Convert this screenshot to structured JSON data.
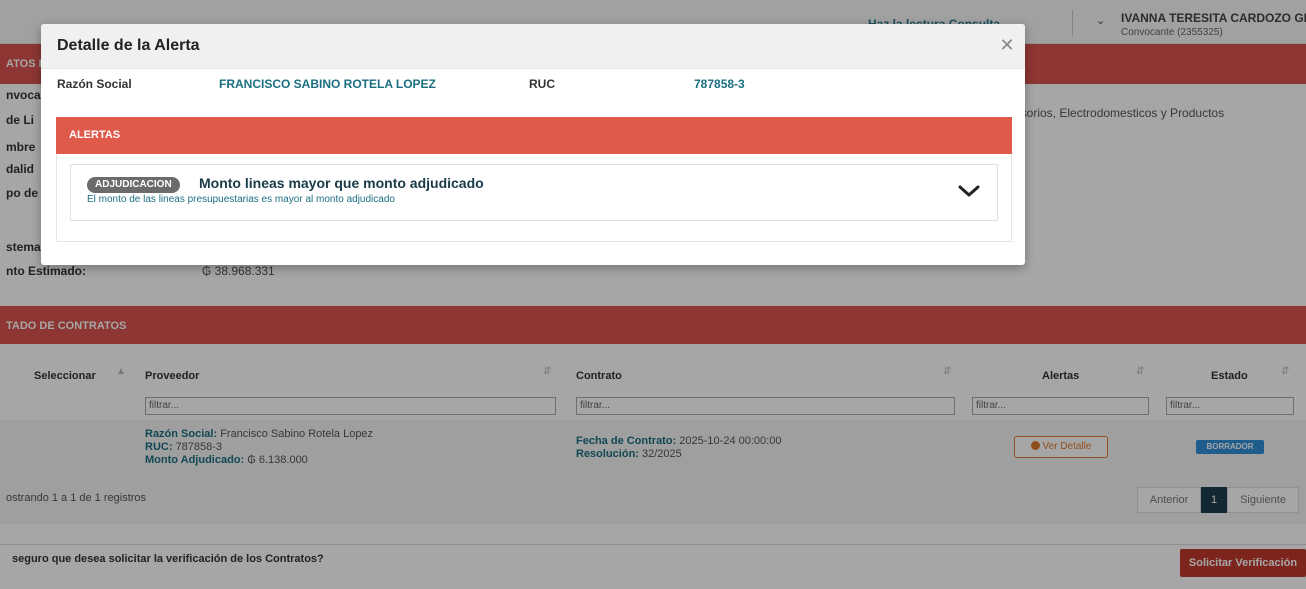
{
  "topbar": {
    "nav_link": "Haz la lectura Consulta",
    "user_name": "IVANNA TERESITA CARDOZO GE",
    "user_role": "Convocante (2355325)"
  },
  "background": {
    "section_datos_label": "ATOS D",
    "field_labels": [
      "nvoca",
      "de Li",
      "mbre",
      "dalid",
      "po de",
      "stema",
      "nto Estimado:"
    ],
    "monto_estimado": "₲ 38.968.331",
    "categoria_text": "esorios, Electrodomesticos y Productos",
    "section_contratos_label": "TADO DE CONTRATOS",
    "table": {
      "headers": [
        "Seleccionar",
        "Proveedor",
        "Contrato",
        "Alertas",
        "Estado"
      ],
      "filter_placeholder": "filtrar...",
      "row": {
        "razon_social_label": "Razón Social:",
        "razon_social": "Francisco Sabino Rotela Lopez",
        "ruc_label": "RUC:",
        "ruc": "787858-3",
        "monto_label": "Monto Adjudicado:",
        "monto": "₲ 6.138.000",
        "fecha_label": "Fecha de Contrato:",
        "fecha": "2025-10-24 00:00:00",
        "resolucion_label": "Resolución:",
        "resolucion": "32/2025",
        "ver_detalle": "Ver Detalle",
        "estado": "BORRADOR"
      }
    },
    "showing": "ostrando 1 a 1 de 1 registros",
    "pager": {
      "prev": "Anterior",
      "page": "1",
      "next": "Siguiente"
    },
    "confirm_text": "seguro que desea solicitar la verificación de los Contratos?",
    "solicitar": "Solicitar Verificación"
  },
  "modal": {
    "title": "Detalle de la Alerta",
    "razon_social_label": "Razón Social",
    "razon_social": "FRANCISCO SABINO ROTELA LOPEZ",
    "ruc_label": "RUC",
    "ruc": "787858-3",
    "alerts_header": "ALERTAS",
    "alert": {
      "tag": "ADJUDICACION",
      "title": "Monto lineas mayor que monto adjudicado",
      "description": "El monto de las lineas presupuestarias es mayor al monto adjudicado"
    }
  },
  "colors": {
    "accent_red": "#d9534f",
    "teal_text": "#1a6f82",
    "orange": "#e0792b",
    "badge_blue": "#2f8fd8"
  }
}
